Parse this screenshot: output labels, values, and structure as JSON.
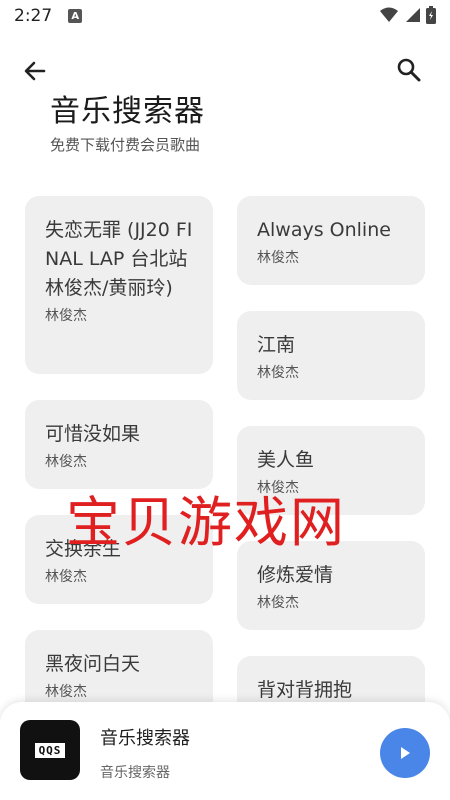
{
  "status_bar": {
    "time": "2:27",
    "notification_letter": "A"
  },
  "header": {
    "title": "音乐搜索器",
    "subtitle": "免费下载付费会员歌曲"
  },
  "songs": [
    {
      "title": "失恋无罪 (JJ20 FINAL LAP 台北站 林俊杰/黄丽玲)",
      "artist": "林俊杰"
    },
    {
      "title": "Always Online",
      "artist": "林俊杰"
    },
    {
      "title": "江南",
      "artist": "林俊杰"
    },
    {
      "title": "可惜没如果",
      "artist": "林俊杰"
    },
    {
      "title": "美人鱼",
      "artist": "林俊杰"
    },
    {
      "title": "交换余生",
      "artist": "林俊杰"
    },
    {
      "title": "修炼爱情",
      "artist": "林俊杰"
    },
    {
      "title": "黑夜问白天",
      "artist": "林俊杰"
    },
    {
      "title": "背对背拥抱",
      "artist": ""
    }
  ],
  "watermark": "宝贝游戏网",
  "player": {
    "art_label": "QQS",
    "title": "音乐搜索器",
    "subtitle": "音乐搜索器"
  },
  "icons": {
    "back": "arrow-left-icon",
    "search": "search-icon",
    "play": "play-icon"
  },
  "colors": {
    "accent": "#4a86e8",
    "card_bg": "#efefef",
    "watermark": "#e02020"
  }
}
